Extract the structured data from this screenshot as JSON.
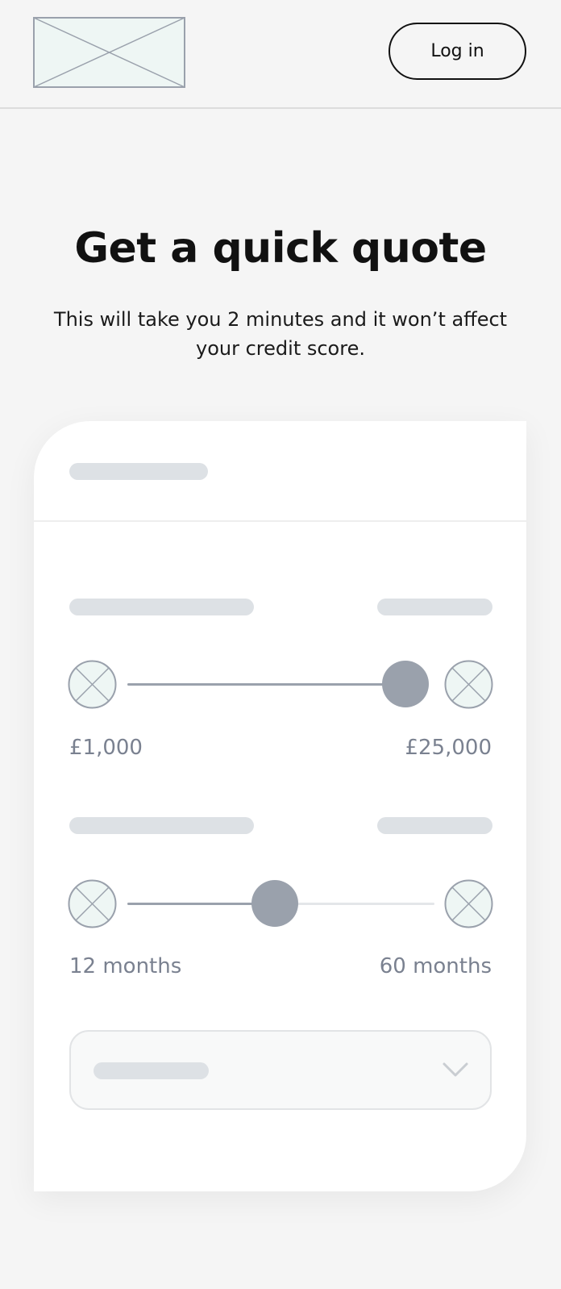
{
  "header": {
    "login_label": "Log in",
    "logo_icon": "image-placeholder-icon"
  },
  "hero": {
    "title": "Get a quick quote",
    "subtitle": "This will take you 2 minutes and it won’t affect your credit score."
  },
  "amount_slider": {
    "min_label": "£1,000",
    "max_label": "£25,000",
    "value_fraction": 1.0,
    "decrease_icon": "image-placeholder-icon",
    "increase_icon": "image-placeholder-icon"
  },
  "term_slider": {
    "min_label": "12 months",
    "max_label": "60 months",
    "value_fraction": 0.5,
    "decrease_icon": "image-placeholder-icon",
    "increase_icon": "image-placeholder-icon"
  },
  "dropdown": {
    "chevron_icon": "chevron-down-icon"
  },
  "colors": {
    "background": "#f5f5f5",
    "card": "#ffffff",
    "skeleton": "#dde1e5",
    "slider_active": "#9aa1ac",
    "slider_inactive": "#e4e6e9",
    "muted_text": "#7a8190"
  }
}
